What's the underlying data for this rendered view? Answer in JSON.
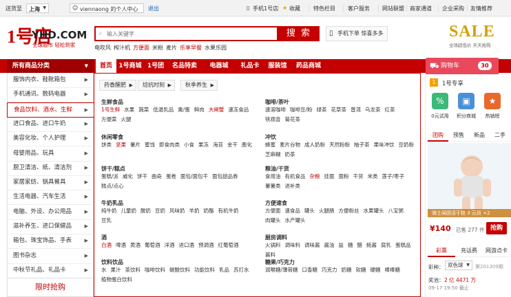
{
  "topbar": {
    "deliver_label": "送货至",
    "city": "上海",
    "user": "viennaong",
    "user_suffix": "的个人中心",
    "logout": "退出",
    "mobile": "手机1号店",
    "favorites": "收藏",
    "special": "特色栏目",
    "service": "客户服务",
    "alliance": "网站联盟",
    "merchant": "商家通道",
    "enterprise": "企业采购",
    "recommend": "友情推荐"
  },
  "logo": {
    "mark": "1号店",
    "domain": "YHD.COM",
    "tagline": "全球超市 轻松到家"
  },
  "search": {
    "placeholder": "输入关键字",
    "button": "搜 索"
  },
  "hot_keywords": [
    "电吹风",
    "榨汁机",
    "方便面",
    "米粉",
    "麦片",
    "乐享早餐",
    "水果乐园"
  ],
  "hot_red": [
    2,
    5
  ],
  "mobile_order": "手机下单 惊喜多多",
  "sale_banner": {
    "title": "SALE",
    "sub": "全场超低价 天天抢购"
  },
  "nav": {
    "all": "所有商品分类",
    "items": [
      "首页",
      "1号商城",
      "1号团",
      "名品特卖",
      "电器城",
      "礼品卡",
      "服装馆",
      "药品商城"
    ],
    "active": 0
  },
  "cart": {
    "label": "购物车",
    "count": "30"
  },
  "categories": [
    "服饰内衣、鞋靴箱包",
    "手机通讯、数码电器",
    "食品饮料、酒水、生鲜",
    "进口食品、进口牛奶",
    "美容化妆、个人护理",
    "母婴用品、玩具",
    "厨卫清洁、纸、清洁剂",
    "家居家纺、锅具餐具",
    "生活电器、汽车生活",
    "电脑、外设、办公用品",
    "滋补养生、进口保健品",
    "箱包、珠宝饰品、手表",
    "图书杂志",
    "中秋节礼品、礼品卡"
  ],
  "active_category": 2,
  "flash_sale": "限时抢购",
  "panel": {
    "tags": [
      "药香醒肥",
      "焙抗时刻",
      "秋季养生"
    ],
    "left": [
      {
        "title": "生鲜食品",
        "items": [
          "1号生鲜",
          "水果",
          "蔬菜",
          "低温乳品",
          "禽/蛋",
          "鲜肉",
          "大闸蟹",
          "速冻食品",
          "方便菜",
          "火腿"
        ],
        "red": [
          0,
          6
        ]
      },
      {
        "title": "休闲零食",
        "items": [
          "饼类",
          "坚果",
          "薯片",
          "蜜饯",
          "即食肉类",
          "小食",
          "果冻",
          "海苔",
          "金干",
          "膨化"
        ],
        "red": [
          1
        ]
      },
      {
        "title": "饼干/糕点",
        "items": [
          "蛋糕/派",
          "威化",
          "饼干",
          "曲奇",
          "蛋卷",
          "面包/面包干",
          "面包甜品券",
          "糕点/点心"
        ],
        "red": []
      },
      {
        "title": "牛奶乳品",
        "items": [
          "纯牛奶",
          "儿童奶",
          "酸奶",
          "豆奶",
          "风味奶",
          "羊奶",
          "奶酪",
          "有机牛奶",
          "豆乳"
        ],
        "red": []
      },
      {
        "title": "酒",
        "items": [
          "白酒",
          "啤酒",
          "黄酒",
          "葡萄酒",
          "洋酒",
          "进口酒",
          "预调酒",
          "红葡萄酒"
        ],
        "red": [
          0
        ]
      },
      {
        "title": "饮料饮品",
        "items": [
          "水",
          "果汁",
          "茶饮料",
          "咖啡饮料",
          "碳酸饮料",
          "功能饮料",
          "乳品",
          "苏打水",
          "植物蛋白饮料"
        ],
        "red": []
      }
    ],
    "right": [
      {
        "title": "咖啡/茶叶",
        "items": [
          "速溶咖啡",
          "咖啡豆/粉",
          "绿茶",
          "花草茶",
          "普洱",
          "乌龙茶",
          "红茶",
          "铁观音",
          "菊花茶"
        ],
        "red": []
      },
      {
        "title": "冲饮",
        "items": [
          "蜂蜜",
          "麦片谷物",
          "成人奶粉",
          "天然粉粉",
          "柚子茶",
          "果味冲饮",
          "豆奶粉",
          "芝麻糊",
          "奶茶"
        ],
        "red": []
      },
      {
        "title": "粮油/干货",
        "items": [
          "食用油",
          "有机食品",
          "杂粮",
          "挂面",
          "面粉",
          "干货",
          "米类",
          "莲子/枣子",
          "薯薯类",
          "进补类"
        ],
        "red": [
          2
        ]
      },
      {
        "title": "方便速食",
        "items": [
          "方便面",
          "速食品",
          "罐头",
          "火腿肠",
          "方便粉丝",
          "水果罐头",
          "八宝粥",
          "肉罐头",
          "水产罐头"
        ],
        "red": []
      },
      {
        "title": "厨房调料",
        "items": [
          "火锅料",
          "调味料",
          "调味酱",
          "酱油",
          "盐",
          "糖",
          "醋",
          "蚝酱",
          "腐乳",
          "蛋糕品",
          "酱料"
        ],
        "red": []
      },
      {
        "title": "糖果/巧克力",
        "items": [
          "润喉糖/薄荷糖",
          "口香糖",
          "巧克力",
          "奶糖",
          "软糖",
          "硬糖",
          "棒棒糖"
        ],
        "red": []
      }
    ]
  },
  "right_panel": {
    "zhuanxiang": "1号专享",
    "icons": [
      {
        "label": "0元试用",
        "color": "#3cb878",
        "glyph": "%"
      },
      {
        "label": "积分商城",
        "color": "#4a90d9",
        "glyph": "▣"
      },
      {
        "label": "热销榜",
        "color": "#e8692b",
        "glyph": "★"
      }
    ],
    "tabs": [
      "团购",
      "预售",
      "新品",
      "二手"
    ],
    "product_caption": "骑士闺团活于抢 3 元货 +2",
    "price": "¥140",
    "sold": "已售 277 件",
    "buy": "抢购",
    "bottom_tabs": [
      "彩票",
      "充话费",
      "网游点卡"
    ],
    "lottery_label": "彩种：",
    "lottery_value": "双色球",
    "lottery_issue": "第201309期",
    "prize_label": "奖池：",
    "prize_value": "2 亿 4471 万",
    "deadline": "09-17 19:50 截止"
  }
}
